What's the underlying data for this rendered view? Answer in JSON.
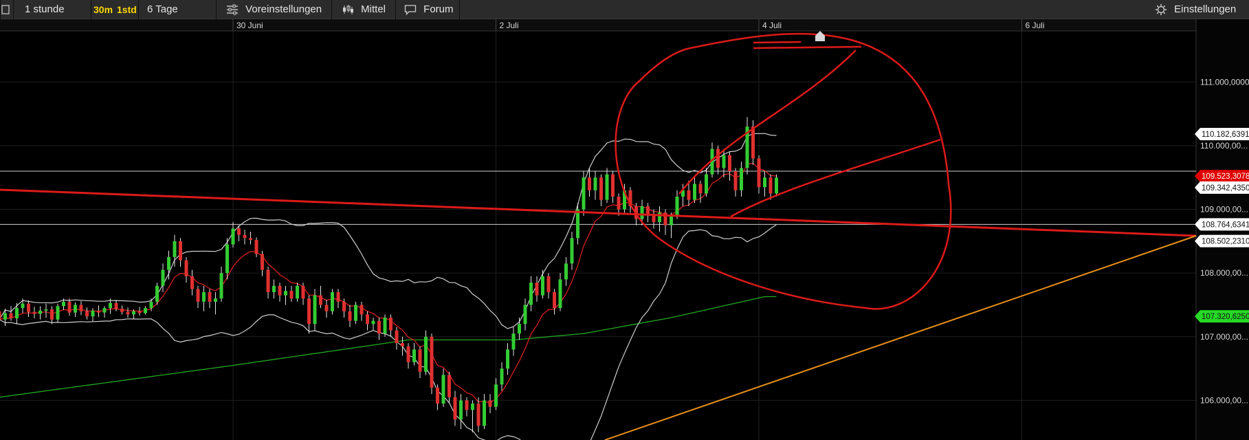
{
  "toolbar": {
    "interval": "1 stunde",
    "btn_30m": "30m",
    "btn_1std": "1std",
    "range": "6 Tage",
    "presets": "Voreinstellungen",
    "indicator": "Mittel",
    "forum": "Forum",
    "settings": "Einstellungen"
  },
  "colors": {
    "background": "#000000",
    "bull": "#33cc33",
    "bear": "#e03030",
    "bollinger": "#cfcfcf",
    "ema_fast": "#d42020",
    "sma_long": "#22a822",
    "trendline_orange": "#e8901a",
    "annotation_red": "#dd1a1a"
  },
  "icons": [
    "grid-icon",
    "sliders-icon",
    "candlestick-icon",
    "speech-bubble-icon",
    "gear-icon",
    "home-marker-icon"
  ],
  "chart_data": {
    "type": "candlestick",
    "x_ticks": [
      {
        "label": "30 Juni",
        "index": 40
      },
      {
        "label": "2 Juli",
        "index": 85
      },
      {
        "label": "4 Juli",
        "index": 130
      },
      {
        "label": "6 Juli",
        "index": 175
      }
    ],
    "y_ticks": [
      "111.000,0000",
      "110.000,00...",
      "109.000,00...",
      "108.000,00...",
      "107.000,00...",
      "106.000,00..."
    ],
    "y_tick_values": [
      111.0,
      110.0,
      109.0,
      108.0,
      107.0,
      106.0
    ],
    "ylim": [
      105.4,
      111.6
    ],
    "price_tags": [
      {
        "label": "110.182,6391",
        "value": 110.183,
        "style": "white"
      },
      {
        "label": "109.523,3078",
        "value": 109.523,
        "style": "red"
      },
      {
        "label": "109.342,4350",
        "value": 109.342,
        "style": "white"
      },
      {
        "label": "108.764,6341",
        "value": 108.764,
        "style": "white"
      },
      {
        "label": "108.502,2310",
        "value": 108.502,
        "style": "white"
      },
      {
        "label": "107.320,6250",
        "value": 107.321,
        "style": "green"
      }
    ],
    "horizontal_lines": [
      109.6,
      108.764
    ],
    "candles": [
      [
        107.4,
        107.42,
        107.18,
        107.27
      ],
      [
        107.27,
        107.44,
        107.17,
        107.37
      ],
      [
        107.37,
        107.48,
        107.25,
        107.29
      ],
      [
        107.29,
        107.53,
        107.2,
        107.45
      ],
      [
        107.45,
        107.6,
        107.37,
        107.52
      ],
      [
        107.52,
        107.57,
        107.31,
        107.39
      ],
      [
        107.39,
        107.47,
        107.29,
        107.36
      ],
      [
        107.36,
        107.48,
        107.27,
        107.41
      ],
      [
        107.41,
        107.52,
        107.3,
        107.43
      ],
      [
        107.43,
        107.48,
        107.2,
        107.27
      ],
      [
        107.27,
        107.52,
        107.23,
        107.48
      ],
      [
        107.48,
        107.6,
        107.42,
        107.55
      ],
      [
        107.55,
        107.6,
        107.33,
        107.38
      ],
      [
        107.38,
        107.54,
        107.31,
        107.5
      ],
      [
        107.5,
        107.56,
        107.34,
        107.4
      ],
      [
        107.4,
        107.46,
        107.27,
        107.32
      ],
      [
        107.32,
        107.45,
        107.24,
        107.41
      ],
      [
        107.41,
        107.49,
        107.31,
        107.38
      ],
      [
        107.38,
        107.48,
        107.3,
        107.45
      ],
      [
        107.45,
        107.6,
        107.36,
        107.53
      ],
      [
        107.53,
        107.58,
        107.4,
        107.44
      ],
      [
        107.44,
        107.49,
        107.35,
        107.39
      ],
      [
        107.39,
        107.46,
        107.3,
        107.35
      ],
      [
        107.35,
        107.43,
        107.28,
        107.4
      ],
      [
        107.4,
        107.47,
        107.33,
        107.37
      ],
      [
        107.37,
        107.48,
        107.35,
        107.45
      ],
      [
        107.45,
        107.6,
        107.4,
        107.55
      ],
      [
        107.55,
        107.85,
        107.5,
        107.8
      ],
      [
        107.8,
        108.15,
        107.7,
        108.05
      ],
      [
        108.05,
        108.35,
        107.9,
        108.25
      ],
      [
        108.25,
        108.6,
        108.1,
        108.5
      ],
      [
        108.5,
        108.55,
        108.1,
        108.2
      ],
      [
        108.2,
        108.25,
        107.85,
        107.95
      ],
      [
        107.95,
        108.05,
        107.65,
        107.75
      ],
      [
        107.75,
        107.8,
        107.45,
        107.55
      ],
      [
        107.55,
        107.8,
        107.4,
        107.7
      ],
      [
        107.7,
        107.75,
        107.45,
        107.55
      ],
      [
        107.55,
        107.7,
        107.35,
        107.6
      ],
      [
        107.6,
        108.1,
        107.55,
        108.0
      ],
      [
        108.0,
        108.55,
        107.9,
        108.45
      ],
      [
        108.45,
        108.8,
        108.4,
        108.7
      ],
      [
        108.7,
        108.75,
        108.5,
        108.6
      ],
      [
        108.6,
        108.68,
        108.45,
        108.55
      ],
      [
        108.55,
        108.65,
        108.45,
        108.52
      ],
      [
        108.52,
        108.56,
        108.25,
        108.3
      ],
      [
        108.3,
        108.35,
        107.95,
        108.05
      ],
      [
        108.05,
        108.1,
        107.6,
        107.7
      ],
      [
        107.7,
        107.9,
        107.6,
        107.8
      ],
      [
        107.8,
        107.85,
        107.55,
        107.65
      ],
      [
        107.65,
        107.8,
        107.5,
        107.72
      ],
      [
        107.72,
        107.8,
        107.55,
        107.6
      ],
      [
        107.6,
        107.85,
        107.55,
        107.8
      ],
      [
        107.8,
        107.85,
        107.5,
        107.6
      ],
      [
        107.6,
        107.65,
        107.05,
        107.2
      ],
      [
        107.2,
        107.75,
        107.1,
        107.65
      ],
      [
        107.65,
        107.8,
        107.45,
        107.5
      ],
      [
        107.5,
        107.58,
        107.3,
        107.4
      ],
      [
        107.4,
        107.75,
        107.35,
        107.7
      ],
      [
        107.7,
        107.75,
        107.45,
        107.55
      ],
      [
        107.55,
        107.6,
        107.3,
        107.4
      ],
      [
        107.4,
        107.5,
        107.15,
        107.25
      ],
      [
        107.25,
        107.55,
        107.2,
        107.5
      ],
      [
        107.5,
        107.55,
        107.25,
        107.35
      ],
      [
        107.35,
        107.4,
        107.1,
        107.2
      ],
      [
        107.2,
        107.3,
        107.1,
        107.25
      ],
      [
        107.25,
        107.3,
        106.95,
        107.05
      ],
      [
        107.05,
        107.35,
        107.0,
        107.3
      ],
      [
        107.3,
        107.35,
        107.0,
        107.1
      ],
      [
        107.1,
        107.15,
        106.8,
        106.9
      ],
      [
        106.9,
        107.0,
        106.7,
        106.85
      ],
      [
        106.85,
        106.9,
        106.5,
        106.6
      ],
      [
        106.6,
        106.9,
        106.55,
        106.8
      ],
      [
        106.8,
        106.85,
        106.35,
        106.45
      ],
      [
        106.45,
        107.1,
        106.4,
        107.0
      ],
      [
        107.0,
        107.05,
        106.1,
        106.2
      ],
      [
        106.2,
        106.25,
        105.85,
        105.95
      ],
      [
        105.95,
        106.5,
        105.9,
        106.4
      ],
      [
        106.4,
        106.45,
        105.95,
        106.05
      ],
      [
        106.05,
        106.15,
        105.6,
        105.7
      ],
      [
        105.7,
        106.1,
        105.55,
        106.0
      ],
      [
        106.0,
        106.05,
        105.75,
        105.85
      ],
      [
        105.85,
        106.0,
        105.5,
        105.95
      ],
      [
        105.95,
        106.05,
        105.5,
        105.6
      ],
      [
        105.6,
        106.1,
        105.55,
        106.0
      ],
      [
        106.0,
        106.1,
        105.8,
        105.9
      ],
      [
        105.9,
        106.35,
        105.85,
        106.25
      ],
      [
        106.25,
        106.6,
        106.15,
        106.5
      ],
      [
        106.5,
        106.9,
        106.4,
        106.8
      ],
      [
        106.8,
        107.15,
        106.7,
        107.05
      ],
      [
        107.05,
        107.3,
        106.95,
        107.2
      ],
      [
        107.2,
        107.6,
        107.1,
        107.5
      ],
      [
        107.5,
        107.95,
        107.4,
        107.85
      ],
      [
        107.85,
        107.95,
        107.55,
        107.65
      ],
      [
        107.65,
        108.05,
        107.6,
        107.95
      ],
      [
        107.95,
        108.0,
        107.6,
        107.7
      ],
      [
        107.7,
        107.75,
        107.35,
        107.45
      ],
      [
        107.45,
        108.0,
        107.4,
        107.9
      ],
      [
        107.9,
        108.25,
        107.8,
        108.15
      ],
      [
        108.15,
        108.65,
        108.05,
        108.55
      ],
      [
        108.55,
        109.1,
        108.45,
        109.0
      ],
      [
        109.0,
        109.6,
        108.9,
        109.5
      ],
      [
        109.5,
        109.65,
        109.2,
        109.3
      ],
      [
        109.3,
        109.6,
        109.15,
        109.5
      ],
      [
        109.5,
        109.55,
        109.05,
        109.15
      ],
      [
        109.15,
        109.65,
        109.1,
        109.55
      ],
      [
        109.55,
        109.6,
        109.1,
        109.2
      ],
      [
        109.2,
        109.25,
        108.9,
        109.0
      ],
      [
        109.0,
        109.4,
        108.95,
        109.3
      ],
      [
        109.3,
        109.35,
        108.95,
        109.05
      ],
      [
        109.05,
        109.1,
        108.75,
        108.85
      ],
      [
        108.85,
        109.15,
        108.75,
        109.05
      ],
      [
        109.05,
        109.1,
        108.8,
        108.9
      ],
      [
        108.9,
        109.0,
        108.7,
        108.8
      ],
      [
        108.8,
        109.05,
        108.65,
        108.95
      ],
      [
        108.95,
        109.0,
        108.6,
        108.75
      ],
      [
        108.75,
        108.95,
        108.55,
        108.9
      ],
      [
        108.9,
        109.3,
        108.85,
        109.2
      ],
      [
        109.2,
        109.4,
        109.05,
        109.3
      ],
      [
        109.3,
        109.45,
        109.05,
        109.15
      ],
      [
        109.15,
        109.5,
        109.1,
        109.4
      ],
      [
        109.4,
        109.45,
        109.1,
        109.25
      ],
      [
        109.25,
        109.65,
        109.2,
        109.55
      ],
      [
        109.55,
        110.05,
        109.5,
        109.95
      ],
      [
        109.95,
        110.0,
        109.55,
        109.65
      ],
      [
        109.65,
        109.95,
        109.5,
        109.85
      ],
      [
        109.85,
        109.9,
        109.45,
        109.6
      ],
      [
        109.6,
        109.65,
        109.2,
        109.3
      ],
      [
        109.3,
        109.75,
        109.2,
        109.65
      ],
      [
        109.65,
        110.45,
        109.55,
        110.3
      ],
      [
        110.3,
        110.4,
        109.7,
        109.8
      ],
      [
        109.8,
        109.85,
        109.25,
        109.35
      ],
      [
        109.35,
        109.6,
        109.2,
        109.5
      ],
      [
        109.5,
        109.55,
        109.15,
        109.25
      ],
      [
        109.25,
        109.55,
        109.2,
        109.5
      ]
    ]
  }
}
